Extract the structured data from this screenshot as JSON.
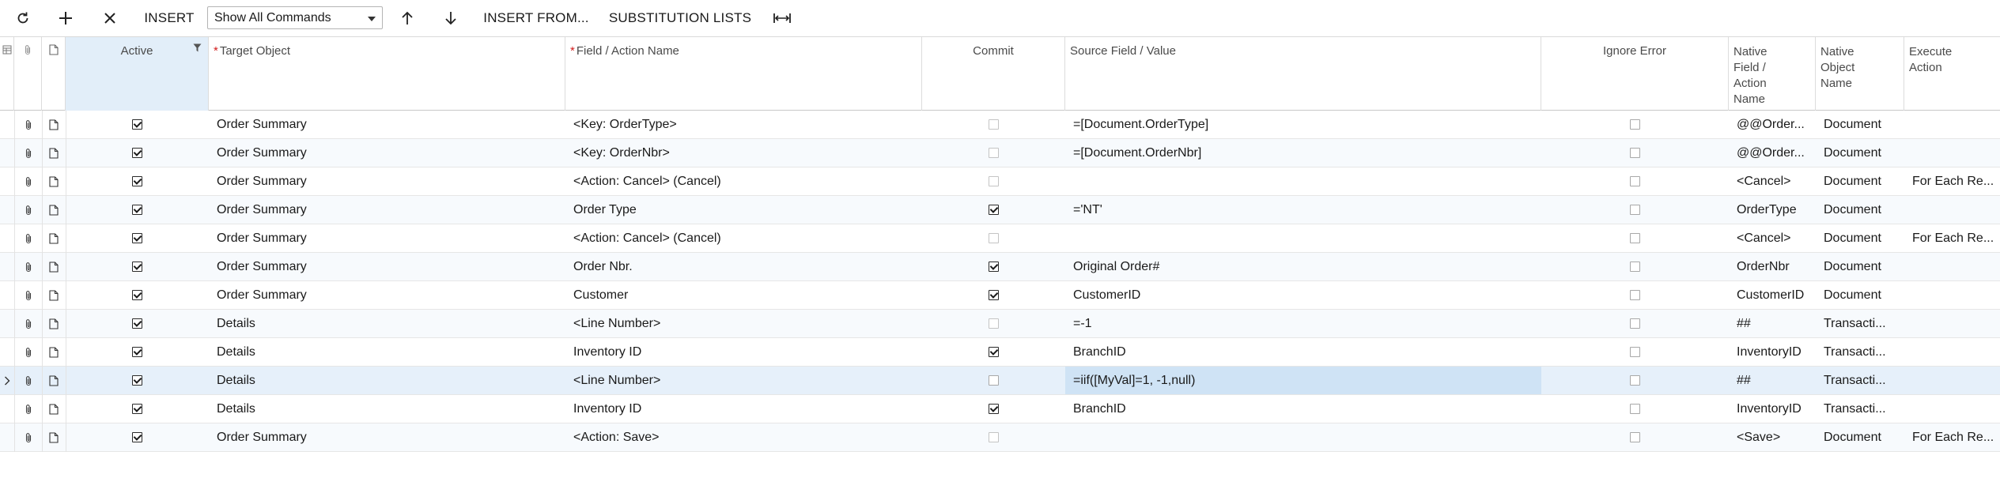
{
  "toolbar": {
    "refresh_icon": "refresh-icon",
    "add_icon": "plus-icon",
    "delete_icon": "close-icon",
    "insert_label": "INSERT",
    "command_filter": "Show All Commands",
    "up_icon": "arrow-up-icon",
    "down_icon": "arrow-down-icon",
    "insert_from_label": "INSERT FROM...",
    "substitution_label": "SUBSTITUTION LISTS",
    "fit_icon": "fit-columns-icon"
  },
  "columns": {
    "active": "Active",
    "target_object": "Target Object",
    "field_action_name": "Field / Action Name",
    "commit": "Commit",
    "source_field_value": "Source Field / Value",
    "ignore_error": "Ignore Error",
    "native_field_action_name": "Native Field / Action Name",
    "native_object_name": "Native Object Name",
    "execute_action": "Execute Action",
    "required_mark": "*"
  },
  "rows": [
    {
      "active": true,
      "target": "Order Summary",
      "field": "<Key: OrderType>",
      "commit": false,
      "commit_disabled": true,
      "source": "=[Document.OrderType]",
      "ignore": false,
      "native_field": "@@Order...",
      "native_object": "Document",
      "execute": ""
    },
    {
      "active": true,
      "target": "Order Summary",
      "field": "<Key: OrderNbr>",
      "commit": false,
      "commit_disabled": true,
      "source": "=[Document.OrderNbr]",
      "ignore": false,
      "native_field": "@@Order...",
      "native_object": "Document",
      "execute": ""
    },
    {
      "active": true,
      "target": "Order Summary",
      "field": "<Action: Cancel> (Cancel)",
      "commit": false,
      "commit_disabled": true,
      "source": "",
      "ignore": false,
      "native_field": "<Cancel>",
      "native_object": "Document",
      "execute": "For Each Re..."
    },
    {
      "active": true,
      "target": "Order Summary",
      "field": "Order Type",
      "commit": true,
      "commit_disabled": false,
      "source": "='NT'",
      "ignore": false,
      "native_field": "OrderType",
      "native_object": "Document",
      "execute": ""
    },
    {
      "active": true,
      "target": "Order Summary",
      "field": "<Action: Cancel> (Cancel)",
      "commit": false,
      "commit_disabled": true,
      "source": "",
      "ignore": false,
      "native_field": "<Cancel>",
      "native_object": "Document",
      "execute": "For Each Re..."
    },
    {
      "active": true,
      "target": "Order Summary",
      "field": "Order Nbr.",
      "commit": true,
      "commit_disabled": false,
      "source": "Original Order#",
      "ignore": false,
      "native_field": "OrderNbr",
      "native_object": "Document",
      "execute": ""
    },
    {
      "active": true,
      "target": "Order Summary",
      "field": "Customer",
      "commit": true,
      "commit_disabled": false,
      "source": "CustomerID",
      "ignore": false,
      "native_field": "CustomerID",
      "native_object": "Document",
      "execute": ""
    },
    {
      "active": true,
      "target": "Details",
      "field": "<Line Number>",
      "commit": false,
      "commit_disabled": true,
      "source": "=-1",
      "ignore": false,
      "native_field": "##",
      "native_object": "Transacti...",
      "execute": ""
    },
    {
      "active": true,
      "target": "Details",
      "field": "Inventory ID",
      "commit": true,
      "commit_disabled": false,
      "source": "BranchID",
      "ignore": false,
      "native_field": "InventoryID",
      "native_object": "Transacti...",
      "execute": ""
    },
    {
      "active": true,
      "target": "Details",
      "field": "<Line Number>",
      "commit": false,
      "commit_disabled": false,
      "source": "=iif([MyVal]=1, -1,null)",
      "ignore": false,
      "native_field": "##",
      "native_object": "Transacti...",
      "execute": "",
      "selected": true
    },
    {
      "active": true,
      "target": "Details",
      "field": "Inventory ID",
      "commit": true,
      "commit_disabled": false,
      "source": "BranchID",
      "ignore": false,
      "native_field": "InventoryID",
      "native_object": "Transacti...",
      "execute": ""
    },
    {
      "active": true,
      "target": "Order Summary",
      "field": "<Action: Save>",
      "commit": false,
      "commit_disabled": true,
      "source": "",
      "ignore": false,
      "native_field": "<Save>",
      "native_object": "Document",
      "execute": "For Each Re..."
    }
  ]
}
